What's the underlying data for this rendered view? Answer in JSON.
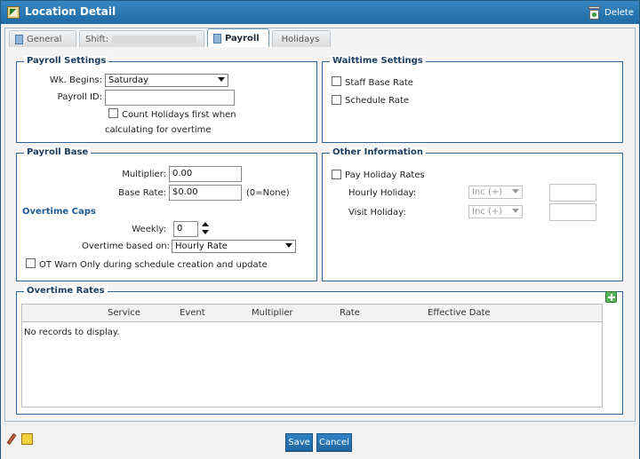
{
  "window": {
    "title": "Location Detail",
    "delete_label": "Delete"
  },
  "tabs": [
    {
      "label": "General",
      "active": false
    },
    {
      "label": "Shift:",
      "active": false
    },
    {
      "label": "Payroll",
      "active": true
    },
    {
      "label": "Holidays",
      "active": false
    }
  ],
  "payroll_settings": {
    "legend": "Payroll Settings",
    "wk_begins_label": "Wk. Begins:",
    "wk_begins_value": "Saturday",
    "payroll_id_label": "Payroll ID:",
    "payroll_id_value": "",
    "count_holidays_label_line1": "Count Holidays first when",
    "count_holidays_label_line2": "calculating for overtime",
    "count_holidays_checked": false
  },
  "waittime_settings": {
    "legend": "Waittime Settings",
    "staff_base_rate_label": "Staff Base Rate",
    "staff_base_rate_checked": false,
    "schedule_rate_label": "Schedule Rate",
    "schedule_rate_checked": false
  },
  "payroll_base": {
    "legend": "Payroll Base",
    "multiplier_label": "Multiplier:",
    "multiplier_value": "0.00",
    "base_rate_label": "Base Rate:",
    "base_rate_value": "$0.00",
    "base_rate_hint": "(0=None)",
    "overtime_caps_heading": "Overtime Caps",
    "weekly_label": "Weekly:",
    "weekly_value": "0",
    "overtime_based_on_label": "Overtime based on:",
    "overtime_based_on_value": "Hourly Rate",
    "ot_warn_label": "OT Warn Only during schedule creation and update",
    "ot_warn_checked": false
  },
  "other_information": {
    "legend": "Other Information",
    "pay_holiday_rates_label": "Pay Holiday Rates",
    "pay_holiday_rates_checked": false,
    "hourly_holiday_label": "Hourly Holiday:",
    "hourly_holiday_select": "Inc (+)",
    "hourly_holiday_value": "",
    "visit_holiday_label": "Visit Holiday:",
    "visit_holiday_select": "Inc (+)",
    "visit_holiday_value": ""
  },
  "overtime_rates": {
    "legend": "Overtime Rates",
    "columns": [
      "Service",
      "Event",
      "Multiplier",
      "Rate",
      "Effective Date"
    ],
    "empty_message": "No records to display."
  },
  "footer": {
    "save_label": "Save",
    "cancel_label": "Cancel"
  },
  "colors": {
    "title_bar": "#1e6aa6",
    "panel_border": "#2a6496",
    "accent_button": "#1f66a3"
  }
}
